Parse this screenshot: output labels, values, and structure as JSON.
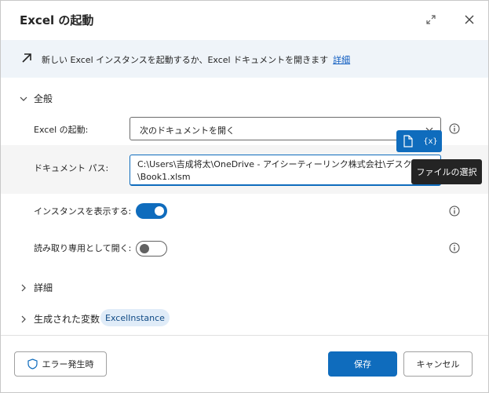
{
  "dialog": {
    "title": "Excel の起動",
    "expand_icon": "expand-icon",
    "close_icon": "close-icon"
  },
  "banner": {
    "icon": "arrow-up-right-icon",
    "text": "新しい Excel インスタンスを起動するか、Excel ドキュメントを開きます",
    "link": "詳細"
  },
  "sections": {
    "general": "全般",
    "advanced": "詳細",
    "variables": "生成された変数"
  },
  "fields": {
    "launch_label": "Excel の起動:",
    "launch_value": "次のドキュメントを開く",
    "path_label": "ドキュメント パス:",
    "path_value": "C:\\Users\\吉成将太\\OneDrive - アイシーティーリンク株式会社\\デスクトップ\n\\Book1.xlsm",
    "show_instance_label": "インスタンスを表示する:",
    "show_instance": true,
    "readonly_label": "読み取り専用として開く:",
    "readonly": false
  },
  "tooltip": "ファイルの選択",
  "variable_name": "ExcelInstance",
  "footer": {
    "on_error": "エラー発生時",
    "save": "保存",
    "cancel": "キャンセル"
  },
  "colors": {
    "accent": "#0f6cbd",
    "banner_bg": "#eff4f9",
    "tooltip_bg": "#242424"
  }
}
